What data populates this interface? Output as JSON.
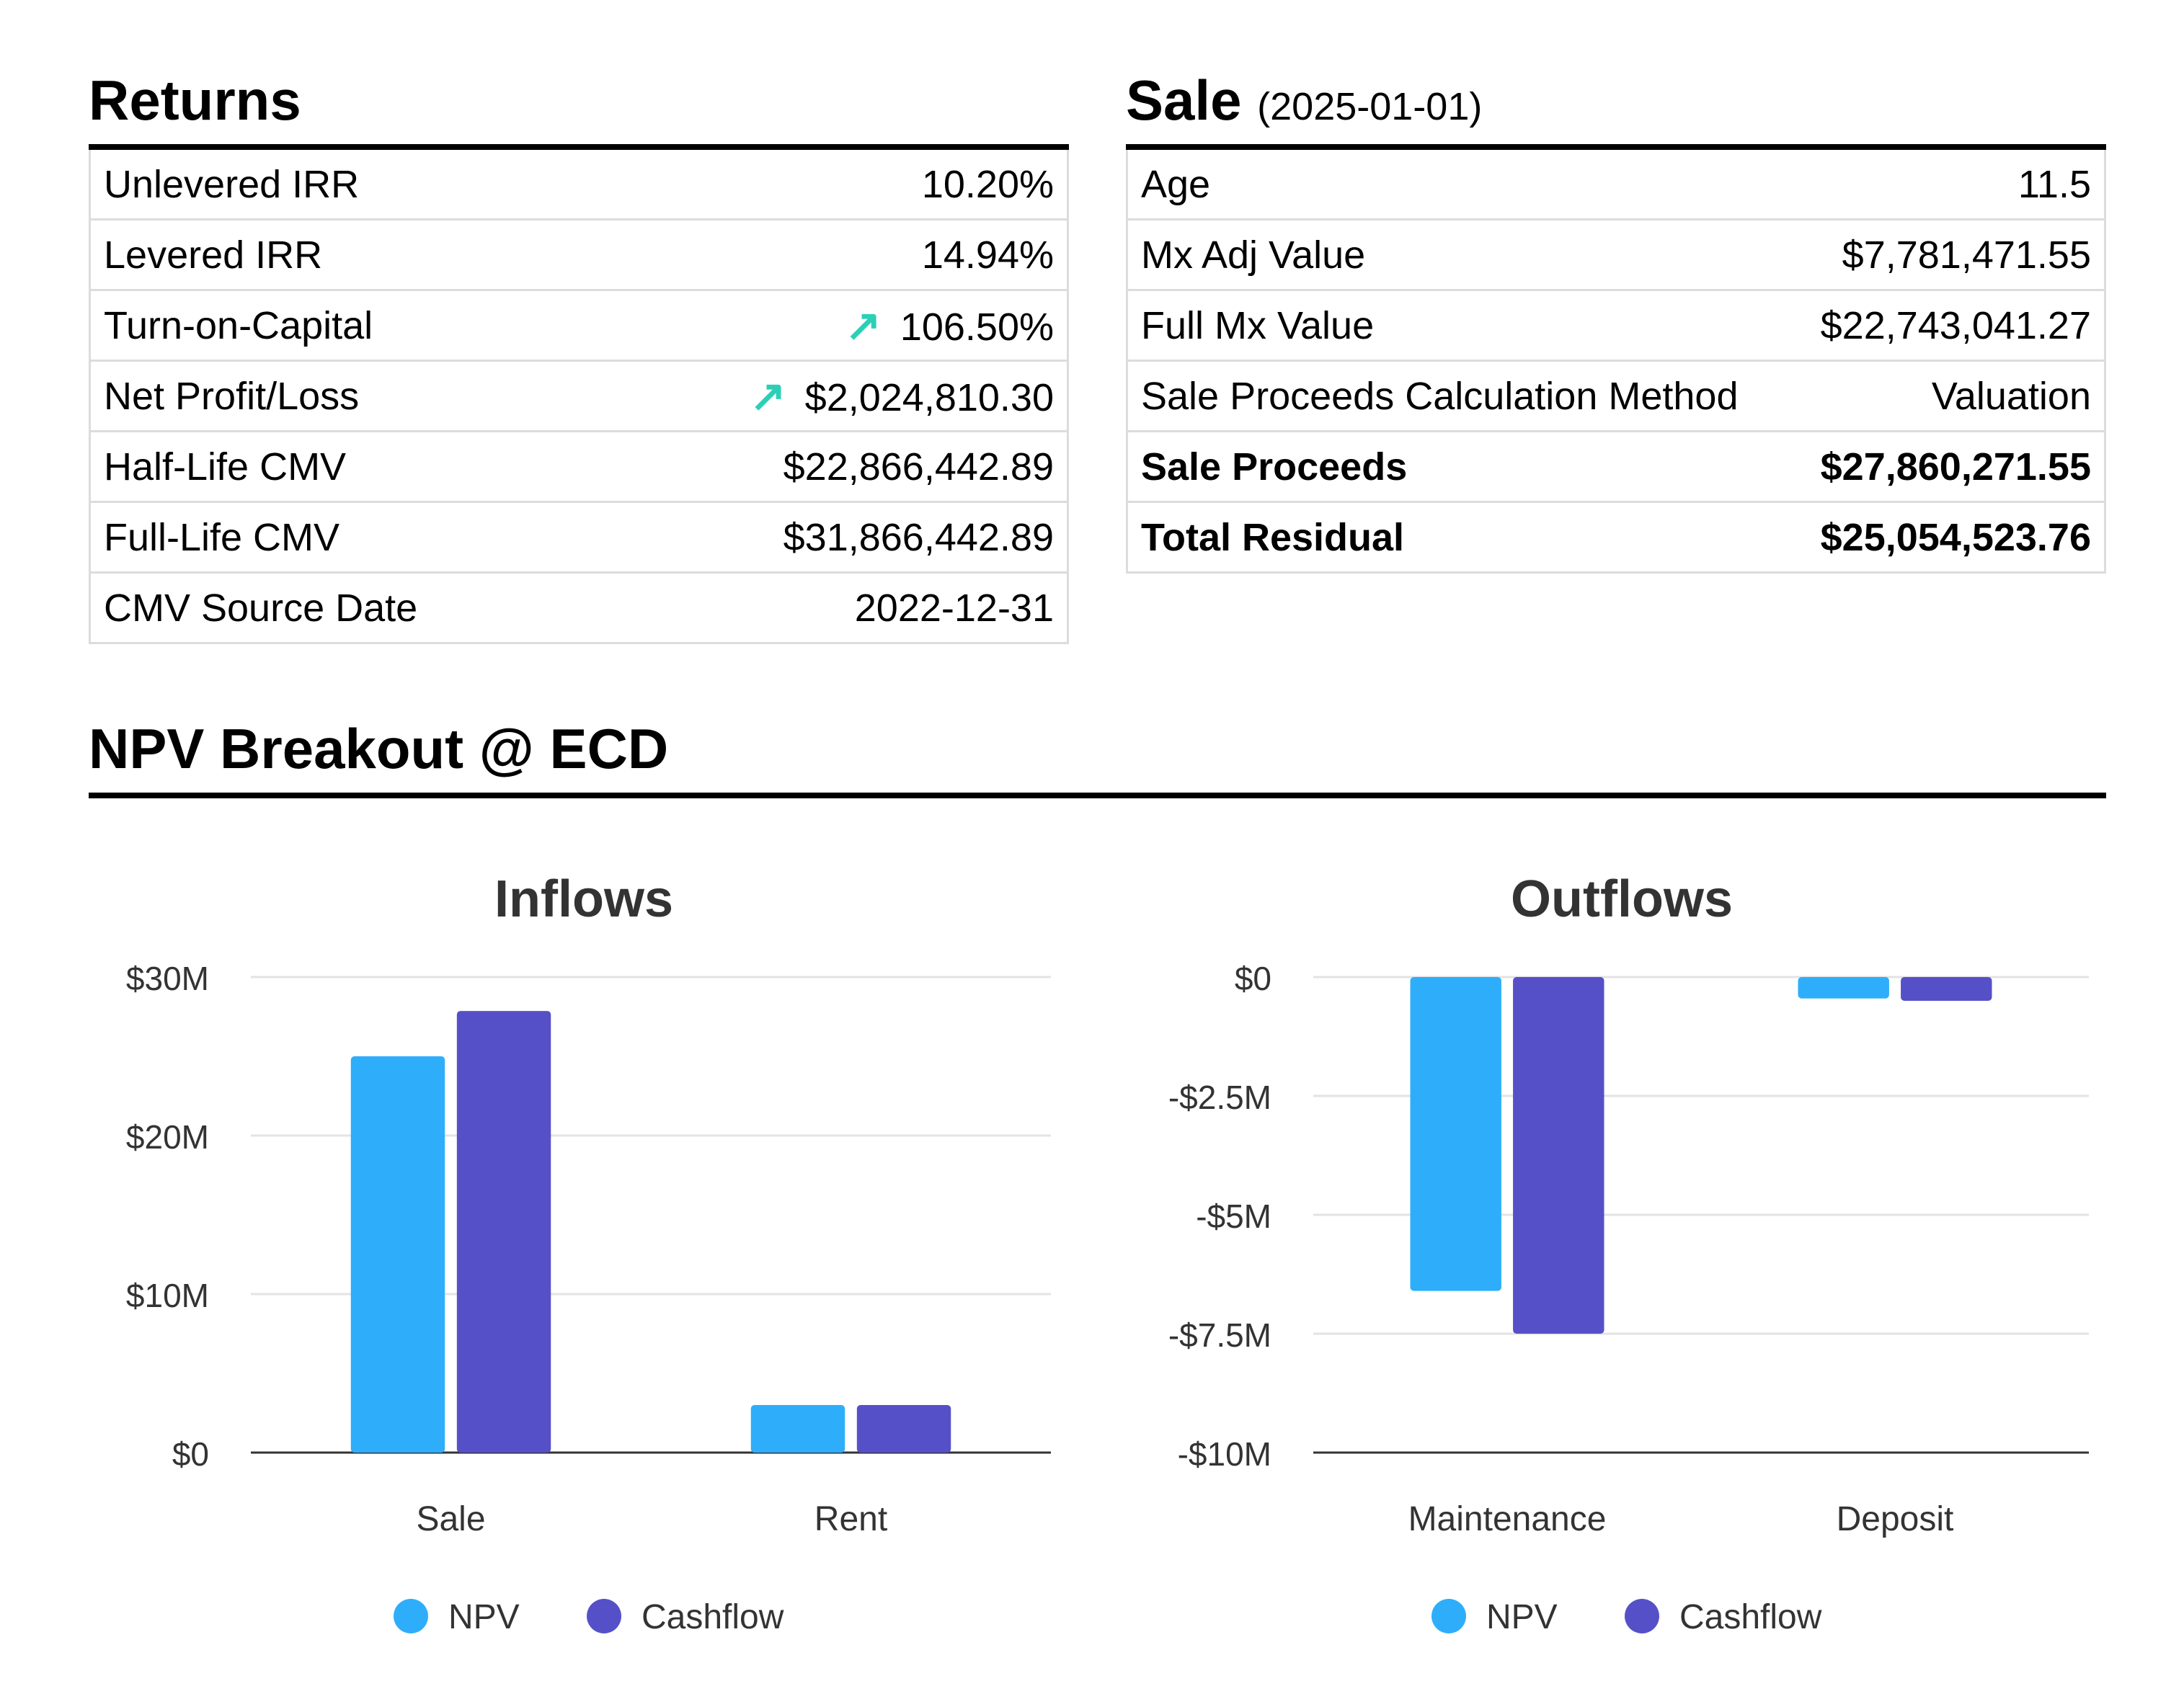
{
  "returns": {
    "title": "Returns",
    "rows": [
      {
        "label": "Unlevered IRR",
        "value": "10.20%",
        "arrow": false,
        "bold": false
      },
      {
        "label": "Levered IRR",
        "value": "14.94%",
        "arrow": false,
        "bold": false
      },
      {
        "label": "Turn-on-Capital",
        "value": "106.50%",
        "arrow": true,
        "bold": false
      },
      {
        "label": "Net Profit/Loss",
        "value": "$2,024,810.30",
        "arrow": true,
        "bold": false
      },
      {
        "label": "Half-Life CMV",
        "value": "$22,866,442.89",
        "arrow": false,
        "bold": false
      },
      {
        "label": "Full-Life CMV",
        "value": "$31,866,442.89",
        "arrow": false,
        "bold": false
      },
      {
        "label": "CMV Source Date",
        "value": "2022-12-31",
        "arrow": false,
        "bold": false
      }
    ]
  },
  "sale": {
    "title": "Sale",
    "date": "(2025-01-01)",
    "rows": [
      {
        "label": "Age",
        "value": "11.5",
        "bold": false
      },
      {
        "label": "Mx Adj Value",
        "value": "$7,781,471.55",
        "bold": false
      },
      {
        "label": "Full Mx Value",
        "value": "$22,743,041.27",
        "bold": false
      },
      {
        "label": "Sale Proceeds Calculation Method",
        "value": "Valuation",
        "bold": false
      },
      {
        "label": "Sale Proceeds",
        "value": "$27,860,271.55",
        "bold": true
      },
      {
        "label": "Total Residual",
        "value": "$25,054,523.76",
        "bold": true
      }
    ]
  },
  "npv_section": {
    "title": "NPV Breakout @ ECD"
  },
  "arrow_icon": "arrow-up-right-icon",
  "colors": {
    "npv": "#2eaefa",
    "cashflow": "#5650c8",
    "arrow": "#2ccfb6"
  },
  "chart_data": [
    {
      "type": "bar",
      "title": "Inflows",
      "categories": [
        "Sale",
        "Rent"
      ],
      "series": [
        {
          "name": "NPV",
          "values": [
            25000000,
            3000000
          ]
        },
        {
          "name": "Cashflow",
          "values": [
            27860271.55,
            3000000
          ]
        }
      ],
      "ylim": [
        0,
        30000000
      ],
      "yticks": [
        0,
        10000000,
        20000000,
        30000000
      ],
      "ytick_labels": [
        "$0",
        "$10M",
        "$20M",
        "$30M"
      ],
      "grid": true,
      "legend": "bottom-center"
    },
    {
      "type": "bar",
      "title": "Outflows",
      "categories": [
        "Maintenance",
        "Deposit"
      ],
      "series": [
        {
          "name": "NPV",
          "values": [
            -6600000,
            -450000
          ]
        },
        {
          "name": "Cashflow",
          "values": [
            -7500000,
            -500000
          ]
        }
      ],
      "ylim": [
        -10000000,
        0
      ],
      "yticks": [
        0,
        -2500000,
        -5000000,
        -7500000,
        -10000000
      ],
      "ytick_labels": [
        "$0",
        "-$2.5M",
        "-$5M",
        "-$7.5M",
        "-$10M"
      ],
      "grid": true,
      "legend": "bottom-center"
    }
  ]
}
